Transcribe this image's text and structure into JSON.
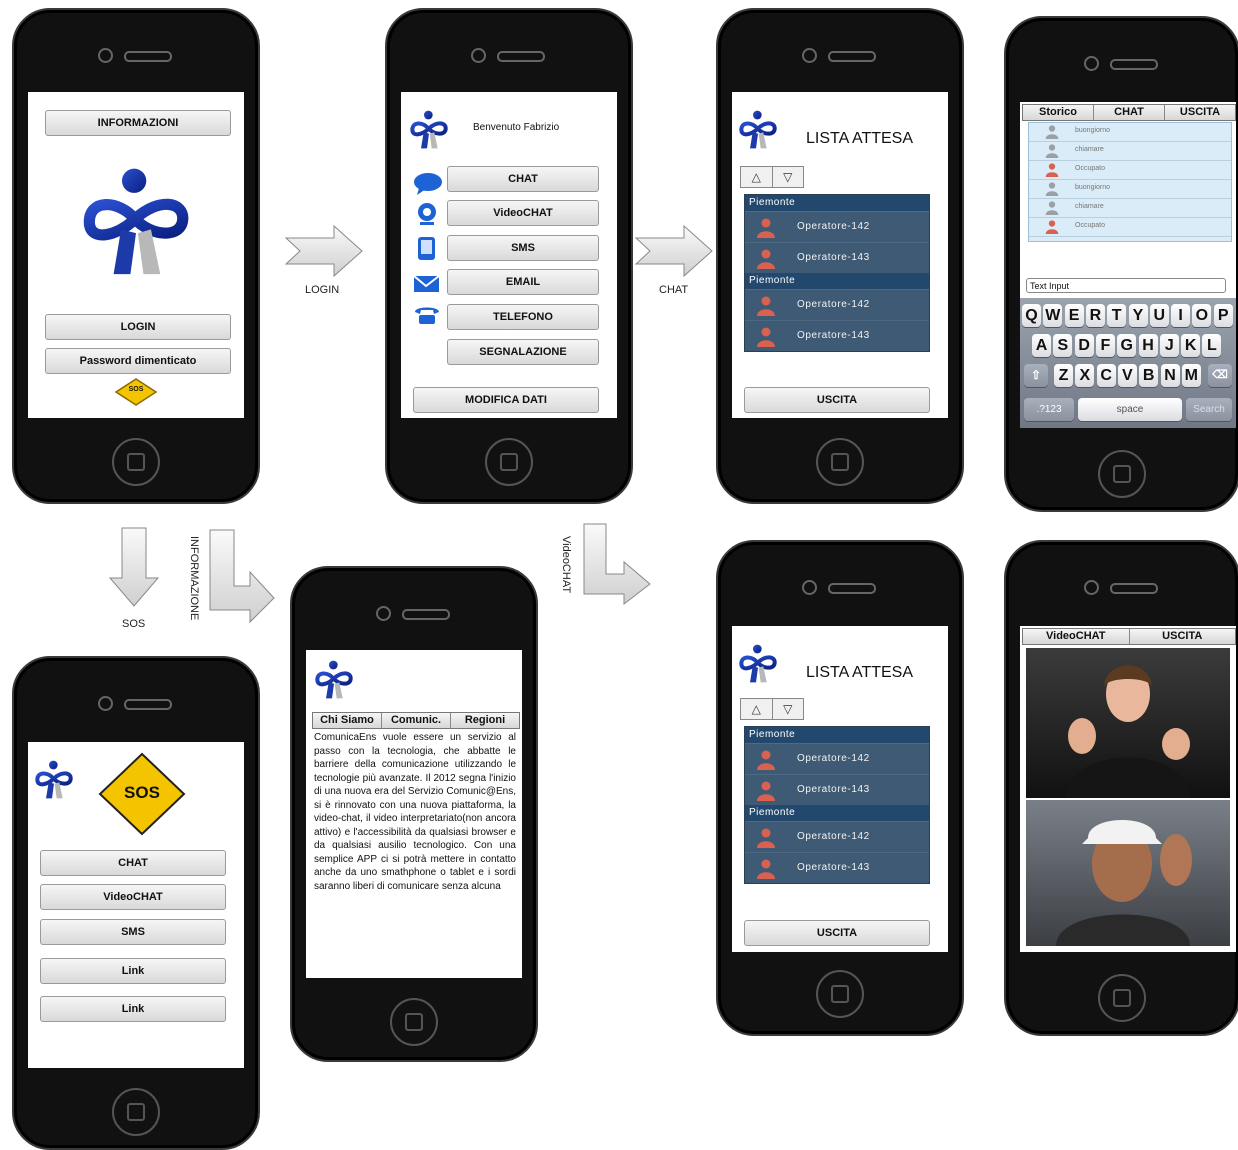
{
  "flow": {
    "login": "LOGIN",
    "chat": "CHAT",
    "sos": "SOS",
    "informazione": "INFORMAZIONE",
    "videochat": "VideoCHAT"
  },
  "screen_home": {
    "info_button": "INFORMAZIONI",
    "login_button": "LOGIN",
    "password_button": "Password dimenticato",
    "sos_badge": "SOS"
  },
  "screen_menu": {
    "welcome": "Benvenuto Fabrizio",
    "items": [
      "CHAT",
      "VideoCHAT",
      "SMS",
      "EMAIL",
      "TELEFONO",
      "SEGNALAZIONE"
    ],
    "edit_button": "MODIFICA DATI"
  },
  "screen_queue": {
    "title": "LISTA ATTESA",
    "up": "△",
    "down": "▽",
    "groups": [
      {
        "region": "Piemonte",
        "operators": [
          "Operatore-142",
          "Operatore-143"
        ]
      },
      {
        "region": "Piemonte",
        "operators": [
          "Operatore-142",
          "Operatore-143"
        ]
      }
    ],
    "exit_button": "USCITA"
  },
  "screen_chat": {
    "tabs": [
      "Storico",
      "CHAT",
      "USCITA"
    ],
    "messages": [
      "buongiorno",
      "chiamare",
      "Occupato",
      "buongiorno",
      "chiamare",
      "Occupato"
    ],
    "input_placeholder": "Text Input",
    "keyboard": {
      "row1": [
        "Q",
        "W",
        "E",
        "R",
        "T",
        "Y",
        "U",
        "I",
        "O",
        "P"
      ],
      "row2": [
        "A",
        "S",
        "D",
        "F",
        "G",
        "H",
        "J",
        "K",
        "L"
      ],
      "row3": [
        "Z",
        "X",
        "C",
        "V",
        "B",
        "N",
        "M"
      ],
      "numbers": ".?123",
      "space": "space",
      "search": "Search"
    }
  },
  "screen_sos": {
    "badge": "SOS",
    "items": [
      "CHAT",
      "VideoCHAT",
      "SMS",
      "Link",
      "Link"
    ]
  },
  "screen_info": {
    "tabs": [
      "Chi Siamo",
      "Comunic.",
      "Regioni"
    ],
    "text": "ComunicaEns vuole essere un servizio al passo con la tecnologia, che abbatte le barriere della comunicazione utilizzando le tecnologie più avanzate. Il 2012 segna l'inizio di una nuova era del Servizio Comunic@Ens, si è rinnovato con una nuova piattaforma, la video-chat, il video interpretariato(non ancora attivo) e l'accessibilità da qualsiasi browser e da qualsiasi ausilio tecnologico. Con una semplice APP ci si potrà mettere in contatto anche da uno smathphone o tablet e i sordi saranno liberi di comunicare senza alcuna"
  },
  "screen_queue2": {
    "title": "LISTA ATTESA",
    "up": "△",
    "down": "▽",
    "groups": [
      {
        "region": "Piemonte",
        "operators": [
          "Operatore-142",
          "Operatore-143"
        ]
      },
      {
        "region": "Piemonte",
        "operators": [
          "Operatore-142",
          "Operatore-143"
        ]
      }
    ],
    "exit_button": "USCITA"
  },
  "screen_video": {
    "tabs": [
      "VideoCHAT",
      "USCITA"
    ]
  }
}
